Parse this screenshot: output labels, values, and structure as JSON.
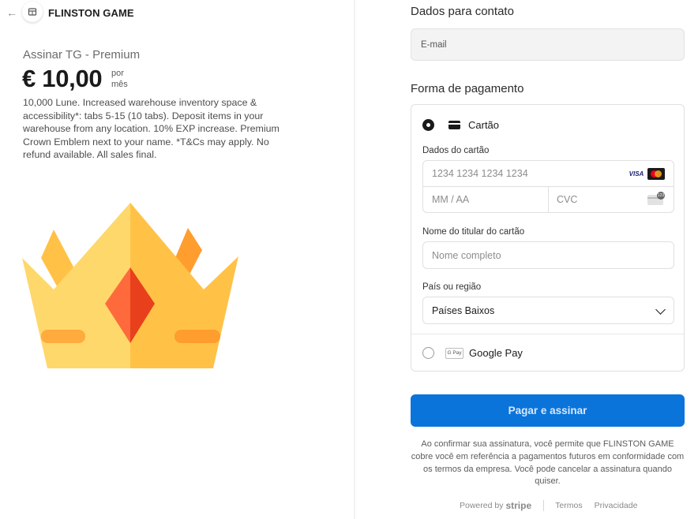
{
  "header": {
    "brand": "FLINSTON GAME",
    "back_icon": "arrow-left-icon",
    "logo_icon": "store-icon"
  },
  "product": {
    "name": "Assinar TG - Premium",
    "price": "€ 10,00",
    "per_1": "por",
    "per_2": "mês",
    "description": "10,000 Lune. Increased warehouse inventory space & accessibility*: tabs 5-15 (10 tabs). Deposit items in your warehouse from any location. 10% EXP increase. Premium Crown Emblem next to your name. *T&Cs may apply. No refund available. All sales final.",
    "image": "crown-illustration",
    "colors": {
      "crown_light": "#ffd86b",
      "crown_mid": "#ffc247",
      "crown_orange": "#ff9d2f",
      "gem_left": "#ff6a3d",
      "gem_right": "#e8401c",
      "band": "#ffab3d"
    }
  },
  "contact": {
    "title": "Dados para contato",
    "email_placeholder": "E-mail"
  },
  "payment": {
    "title": "Forma de pagamento",
    "card_option": "Cartão",
    "card_details_label": "Dados do cartão",
    "card_number_placeholder": "1234 1234 1234 1234",
    "expiry_placeholder": "MM / AA",
    "cvc_placeholder": "CVC",
    "brands": [
      "VISA",
      "mastercard"
    ],
    "holder_label": "Nome do titular do cartão",
    "holder_placeholder": "Nome completo",
    "country_label": "País ou região",
    "country_value": "Países Baixos",
    "gpay_option": "Google Pay",
    "gpay_badge": "G Pay"
  },
  "submit": {
    "label": "Pagar e assinar",
    "color": "#0a74da"
  },
  "legal": "Ao confirmar sua assinatura, você permite que FLINSTON GAME cobre você em referência a pagamentos futuros em conformidade com os termos da empresa. Você pode cancelar a assinatura quando quiser.",
  "footer": {
    "powered_by": "Powered by",
    "stripe": "stripe",
    "terms": "Termos",
    "privacy": "Privacidade"
  }
}
